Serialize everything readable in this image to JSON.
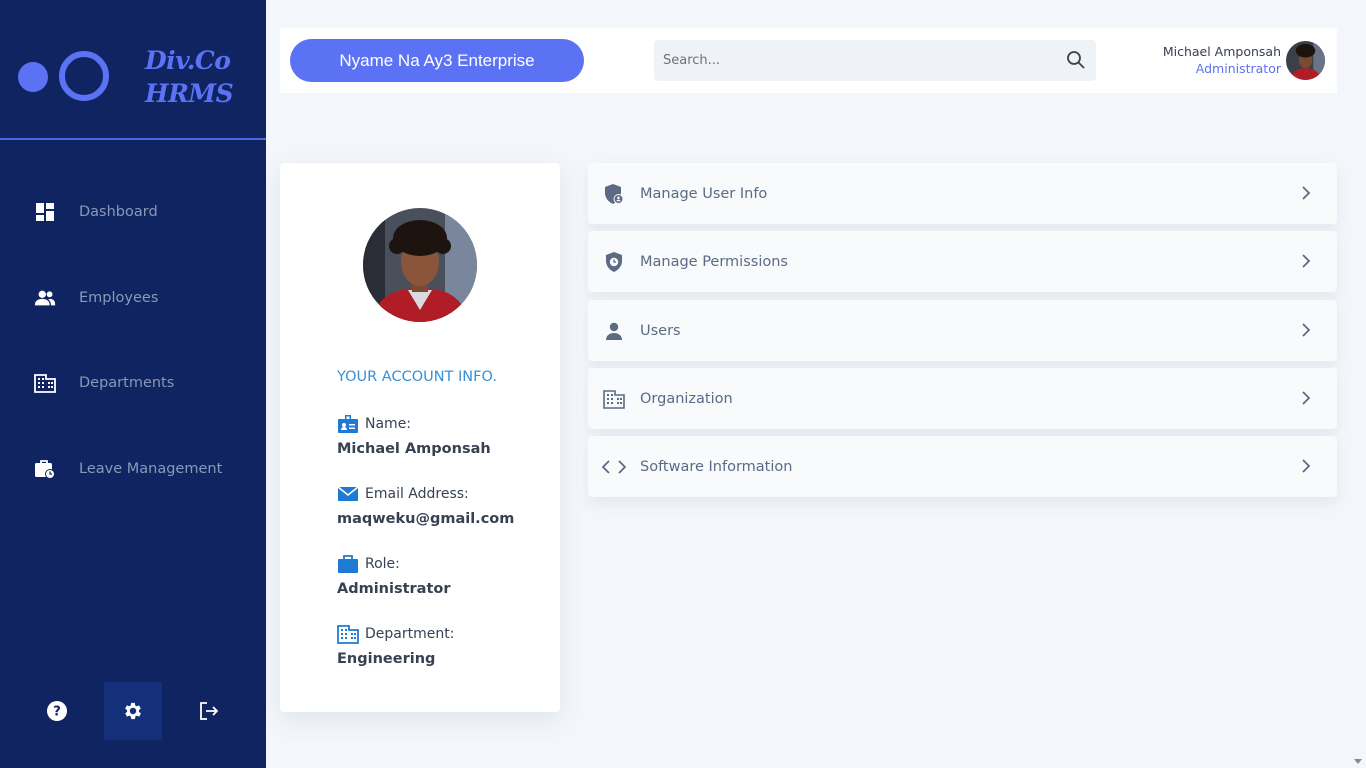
{
  "brand": {
    "line1": "Div.Co",
    "line2": "HRMS"
  },
  "sidebar": {
    "items": [
      {
        "label": "Dashboard",
        "icon": "dashboard-icon"
      },
      {
        "label": "Employees",
        "icon": "people-icon"
      },
      {
        "label": "Departments",
        "icon": "building-icon"
      },
      {
        "label": "Leave Management",
        "icon": "briefcase-clock-icon"
      }
    ],
    "bottom": [
      "help-icon",
      "gear-icon",
      "logout-icon"
    ]
  },
  "topbar": {
    "company": "Nyame Na Ay3 Enterprise",
    "search_placeholder": "Search...",
    "user_name": "Michael Amponsah",
    "user_role": "Administrator"
  },
  "profile": {
    "title": "YOUR ACCOUNT INFO.",
    "fields": [
      {
        "key": "Name:",
        "value": "Michael Amponsah",
        "icon": "id-badge-icon"
      },
      {
        "key": "Email Address:",
        "value": "maqweku@gmail.com",
        "icon": "envelope-icon"
      },
      {
        "key": "Role:",
        "value": "Administrator",
        "icon": "briefcase-icon"
      },
      {
        "key": "Department:",
        "value": "Engineering",
        "icon": "building-icon"
      }
    ]
  },
  "settings": {
    "items": [
      {
        "label": "Manage User Info",
        "icon": "shield-user-icon"
      },
      {
        "label": "Manage Permissions",
        "icon": "shield-clock-icon"
      },
      {
        "label": "Users",
        "icon": "user-icon"
      },
      {
        "label": "Organization",
        "icon": "building-icon"
      },
      {
        "label": "Software Information",
        "icon": "code-icon"
      }
    ]
  },
  "colors": {
    "sidebar": "#0f2461",
    "accent": "#5c72f5",
    "info_title": "#3a8fd4",
    "icon_blue": "#1f7ad4"
  }
}
